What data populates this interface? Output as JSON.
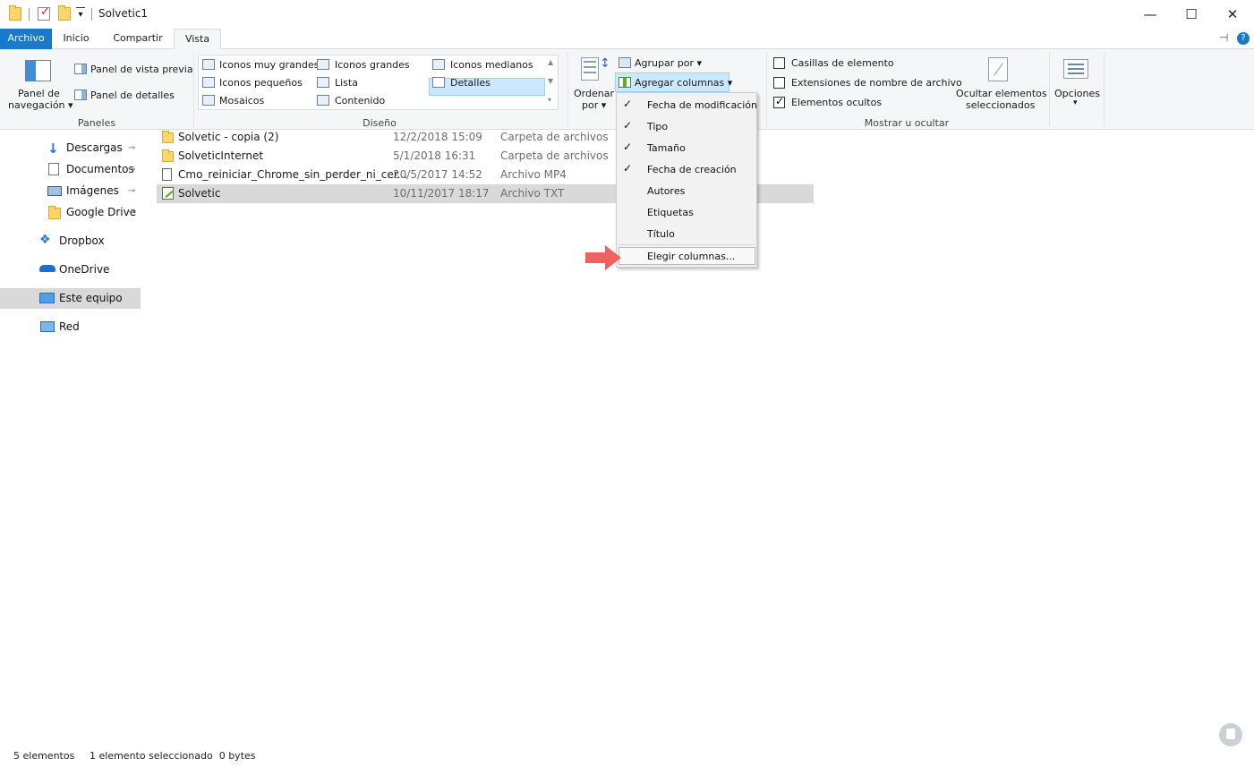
{
  "window": {
    "title": "Solvetic1",
    "qat_customize_icon": "chevron-down-icon",
    "minimize_glyph": "—",
    "maximize_glyph": "☐",
    "close_glyph": "✕"
  },
  "tabs": [
    {
      "label": "Archivo"
    },
    {
      "label": "Inicio"
    },
    {
      "label": "Compartir"
    },
    {
      "label": "Vista"
    }
  ],
  "ribbon": {
    "panels_group": {
      "label": "Paneles",
      "nav_pane_line1": "Panel de",
      "nav_pane_line2": "navegación",
      "preview_pane": "Panel de vista previa",
      "details_pane": "Panel de detalles"
    },
    "layout_group": {
      "label": "Diseño",
      "items": [
        "Iconos muy grandes",
        "Iconos grandes",
        "Iconos medianos",
        "Iconos pequeños",
        "Lista",
        "Detalles",
        "Mosaicos",
        "Contenido"
      ],
      "selected": "Detalles"
    },
    "current_view": {
      "sort_by_line1": "Ordenar",
      "sort_by_line2": "por",
      "group_by": "Agrupar por",
      "add_columns": "Agregar columnas"
    },
    "show_hide": {
      "label": "Mostrar u ocultar",
      "item_checkboxes": "Casillas de elemento",
      "item_checkboxes_checked": false,
      "file_extensions": "Extensiones de nombre de archivo",
      "file_extensions_checked": false,
      "hidden_items": "Elementos ocultos",
      "hidden_items_checked": true,
      "hide_selected_line1": "Ocultar elementos",
      "hide_selected_line2": "seleccionados"
    },
    "options": {
      "label": "Opciones"
    },
    "colors": {
      "file_tab": "#1979ca",
      "selection": "#cce8ff",
      "selection_border": "#99d1ff"
    }
  },
  "nav": {
    "items": [
      {
        "label": "Descargas",
        "icon": "download-icon",
        "pinned": true
      },
      {
        "label": "Documentos",
        "icon": "documents-icon",
        "pinned": true
      },
      {
        "label": "Imágenes",
        "icon": "pictures-icon",
        "pinned": true
      },
      {
        "label": "Google Drive",
        "icon": "folder-icon",
        "pinned": true
      },
      {
        "label": "Dropbox",
        "icon": "dropbox-icon",
        "pinned": false
      },
      {
        "label": "OneDrive",
        "icon": "onedrive-icon",
        "pinned": false
      },
      {
        "label": "Este equipo",
        "icon": "this-pc-icon",
        "pinned": false,
        "selected": true
      },
      {
        "label": "Red",
        "icon": "network-icon",
        "pinned": false
      }
    ],
    "pin_glyph": "📌"
  },
  "files": [
    {
      "name": "Solvetic - copia (2)",
      "date": "12/2/2018 15:09",
      "type": "Carpeta de archivos",
      "icon": "folder-icon"
    },
    {
      "name": "SolveticInternet",
      "date": "5/1/2018 16:31",
      "type": "Carpeta de archivos",
      "icon": "folder-icon"
    },
    {
      "name": "Cmo_reiniciar_Chrome_sin_perder_ni_cer...",
      "date": "20/5/2017 14:52",
      "type": "Archivo MP4",
      "icon": "file-icon"
    },
    {
      "name": "Solvetic",
      "date": "10/11/2017 18:17",
      "type": "Archivo TXT",
      "icon": "text-file-icon",
      "selected": true
    }
  ],
  "add_columns_menu": {
    "items": [
      {
        "label": "Fecha de modificación",
        "checked": true
      },
      {
        "label": "Tipo",
        "checked": true
      },
      {
        "label": "Tamaño",
        "checked": true
      },
      {
        "label": "Fecha de creación",
        "checked": true
      },
      {
        "label": "Autores",
        "checked": false
      },
      {
        "label": "Etiquetas",
        "checked": false
      },
      {
        "label": "Título",
        "checked": false
      }
    ],
    "check_glyph": "✓",
    "choose_columns": "Elegir columnas..."
  },
  "status": {
    "count": "5 elementos",
    "selection": "1 elemento seleccionado  0 bytes"
  }
}
